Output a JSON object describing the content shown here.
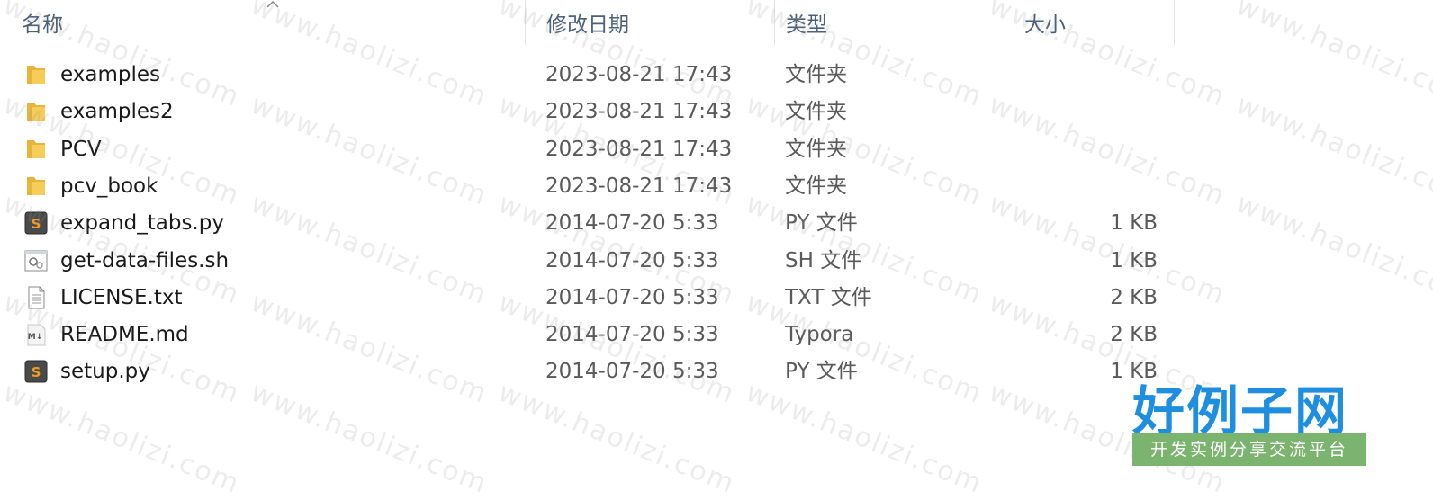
{
  "columns": {
    "name": "名称",
    "date": "修改日期",
    "type": "类型",
    "size": "大小"
  },
  "files": [
    {
      "name": "examples",
      "date": "2023-08-21 17:43",
      "type": "文件夹",
      "size": "",
      "icon": "folder-icon"
    },
    {
      "name": "examples2",
      "date": "2023-08-21 17:43",
      "type": "文件夹",
      "size": "",
      "icon": "folder-icon"
    },
    {
      "name": "PCV",
      "date": "2023-08-21 17:43",
      "type": "文件夹",
      "size": "",
      "icon": "folder-icon"
    },
    {
      "name": "pcv_book",
      "date": "2023-08-21 17:43",
      "type": "文件夹",
      "size": "",
      "icon": "folder-icon"
    },
    {
      "name": "expand_tabs.py",
      "date": "2014-07-20 5:33",
      "type": "PY 文件",
      "size": "1 KB",
      "icon": "sublime-text-icon"
    },
    {
      "name": "get-data-files.sh",
      "date": "2014-07-20 5:33",
      "type": "SH 文件",
      "size": "1 KB",
      "icon": "script-file-icon"
    },
    {
      "name": "LICENSE.txt",
      "date": "2014-07-20 5:33",
      "type": "TXT 文件",
      "size": "2 KB",
      "icon": "text-file-icon"
    },
    {
      "name": "README.md",
      "date": "2014-07-20 5:33",
      "type": "Typora",
      "size": "2 KB",
      "icon": "markdown-file-icon"
    },
    {
      "name": "setup.py",
      "date": "2014-07-20 5:33",
      "type": "PY 文件",
      "size": "1 KB",
      "icon": "sublime-text-icon"
    }
  ],
  "watermark": {
    "text": "www.haolizi.com",
    "brand_title": "好例子网",
    "brand_subtitle": "开发实例分享交流平台"
  },
  "colors": {
    "folder": "#f5c542",
    "brand_blue": "#1e8fe0",
    "brand_green": "#7bb46e"
  }
}
